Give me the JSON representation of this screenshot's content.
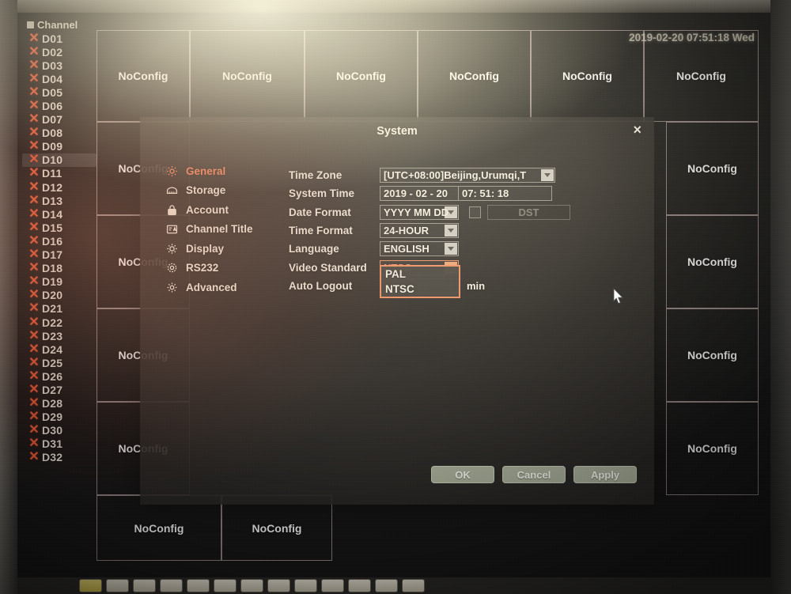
{
  "clock": "2019-02-20 07:51:18 Wed",
  "channel_panel": {
    "header": "Channel",
    "selected": "D10",
    "items": [
      "D01",
      "D02",
      "D03",
      "D04",
      "D05",
      "D06",
      "D07",
      "D08",
      "D09",
      "D10",
      "D11",
      "D12",
      "D13",
      "D14",
      "D15",
      "D16",
      "D17",
      "D18",
      "D19",
      "D20",
      "D21",
      "D22",
      "D23",
      "D24",
      "D25",
      "D26",
      "D27",
      "D28",
      "D29",
      "D30",
      "D31",
      "D32"
    ]
  },
  "live_view": {
    "no_config_label": "NoConfig",
    "top_row": [
      "NoConfig",
      "NoConfig",
      "NoConfig",
      "NoConfig",
      "NoConfig",
      "NoConfig"
    ],
    "left_column": [
      "NoConfig",
      "NoConfig",
      "NoConfig",
      "NoConfig"
    ],
    "right_column": [
      "NoConfig",
      "NoConfig",
      "NoConfig",
      "NoConfig"
    ],
    "bottom_row": [
      "NoConfig",
      "NoConfig"
    ]
  },
  "dialog": {
    "title": "System",
    "close_label": "×",
    "nav": [
      {
        "label": "General",
        "icon": "gear-icon",
        "active": true
      },
      {
        "label": "Storage",
        "icon": "storage-icon",
        "active": false
      },
      {
        "label": "Account",
        "icon": "lock-icon",
        "active": false
      },
      {
        "label": "Channel Title",
        "icon": "channel-title-icon",
        "active": false
      },
      {
        "label": "Display",
        "icon": "brightness-icon",
        "active": false
      },
      {
        "label": "RS232",
        "icon": "gear-flower-icon",
        "active": false
      },
      {
        "label": "Advanced",
        "icon": "gear-outline-icon",
        "active": false
      }
    ],
    "fields": {
      "time_zone": {
        "label": "Time Zone",
        "value": "[UTC+08:00]Beijing,Urumqi,T"
      },
      "system_time": {
        "label": "System Time",
        "date": "2019 - 02 - 20",
        "time": "07: 51: 18"
      },
      "date_format": {
        "label": "Date Format",
        "value": "YYYY MM DD"
      },
      "dst": {
        "label": "DST",
        "checked": false
      },
      "time_format": {
        "label": "Time Format",
        "value": "24-HOUR"
      },
      "language": {
        "label": "Language",
        "value": "ENGLISH"
      },
      "video_standard": {
        "label": "Video Standard",
        "value": "NTSC",
        "options": [
          "PAL",
          "NTSC"
        ],
        "open": true
      },
      "auto_logout": {
        "label": "Auto Logout",
        "value": "",
        "unit": "min"
      }
    },
    "buttons": [
      {
        "label": "OK"
      },
      {
        "label": "Cancel"
      },
      {
        "label": "Apply"
      }
    ]
  },
  "colors": {
    "accent": "#f07a52",
    "dropdown_border": "#ef8a5e",
    "button_bg": "#cdd6bc",
    "channel_x": "#f4603c"
  }
}
